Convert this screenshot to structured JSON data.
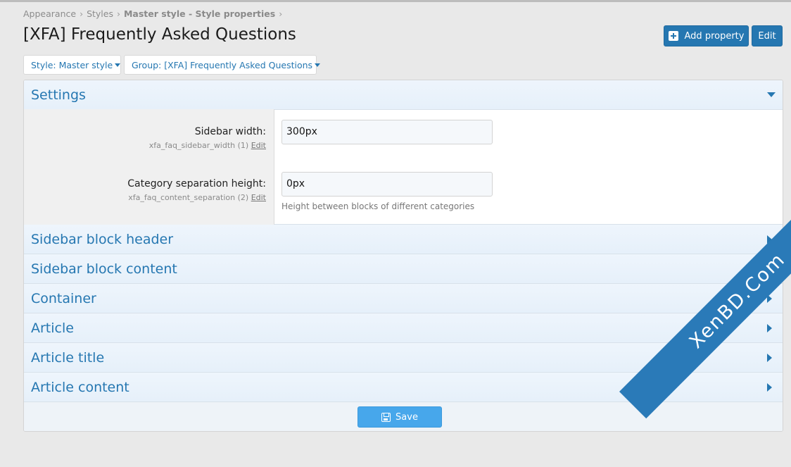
{
  "breadcrumb": {
    "items": [
      "Appearance",
      "Styles",
      "Master style - Style properties"
    ],
    "separator": "›"
  },
  "page": {
    "title": "[XFA] Frequently Asked Questions"
  },
  "actions": {
    "add_property_label": "Add property",
    "edit_label": "Edit"
  },
  "filters": {
    "style_label": "Style: Master style",
    "group_label": "Group: [XFA] Frequently Asked Questions"
  },
  "sections": {
    "settings": {
      "title": "Settings",
      "fields": [
        {
          "label": "Sidebar width:",
          "property": "xfa_faq_sidebar_width (1)",
          "edit_label": "Edit",
          "value": "300px",
          "hint": ""
        },
        {
          "label": "Category separation height:",
          "property": "xfa_faq_content_separation (2)",
          "edit_label": "Edit",
          "value": "0px",
          "hint": "Height between blocks of different categories"
        }
      ]
    },
    "collapsed": [
      {
        "title": "Sidebar block header"
      },
      {
        "title": "Sidebar block content"
      },
      {
        "title": "Container"
      },
      {
        "title": "Article"
      },
      {
        "title": "Article title"
      },
      {
        "title": "Article content"
      }
    ]
  },
  "footer": {
    "save_label": "Save"
  },
  "watermark": {
    "text": "XenBD.Com"
  },
  "colors": {
    "accent": "#2577b1",
    "save_button": "#47a7eb",
    "background": "#e9e9e9"
  }
}
